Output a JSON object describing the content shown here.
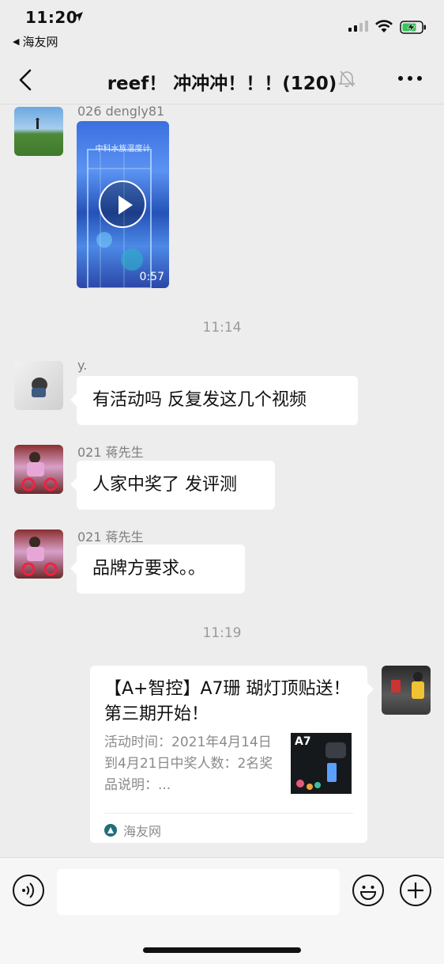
{
  "status_bar": {
    "time": "11:20",
    "back_app": "海友网"
  },
  "nav": {
    "title": "reef！ 冲冲冲！！！(120)"
  },
  "messages": [
    {
      "sender": "026 dengly81",
      "type": "video",
      "caption": "中科水族温度计",
      "duration": "0:57"
    },
    {
      "type": "timestamp",
      "text": "11:14"
    },
    {
      "sender": "y.",
      "type": "text",
      "text": "有活动吗 反复发这几个视频"
    },
    {
      "sender": "021 蒋先生",
      "type": "text",
      "text": "人家中奖了 发评测"
    },
    {
      "sender": "021 蒋先生",
      "type": "text",
      "text": "品牌方要求。。"
    },
    {
      "type": "timestamp",
      "text": "11:19"
    },
    {
      "type": "link",
      "title": "【A+智控】A7珊 瑚灯顶贴送！第三期开始！",
      "description": "活动时间：2021年4月14日到4月21日中奖人数：2名奖品说明：...",
      "thumb_label": "A7",
      "source": "海友网"
    }
  ],
  "input": {
    "value": "",
    "placeholder": ""
  }
}
